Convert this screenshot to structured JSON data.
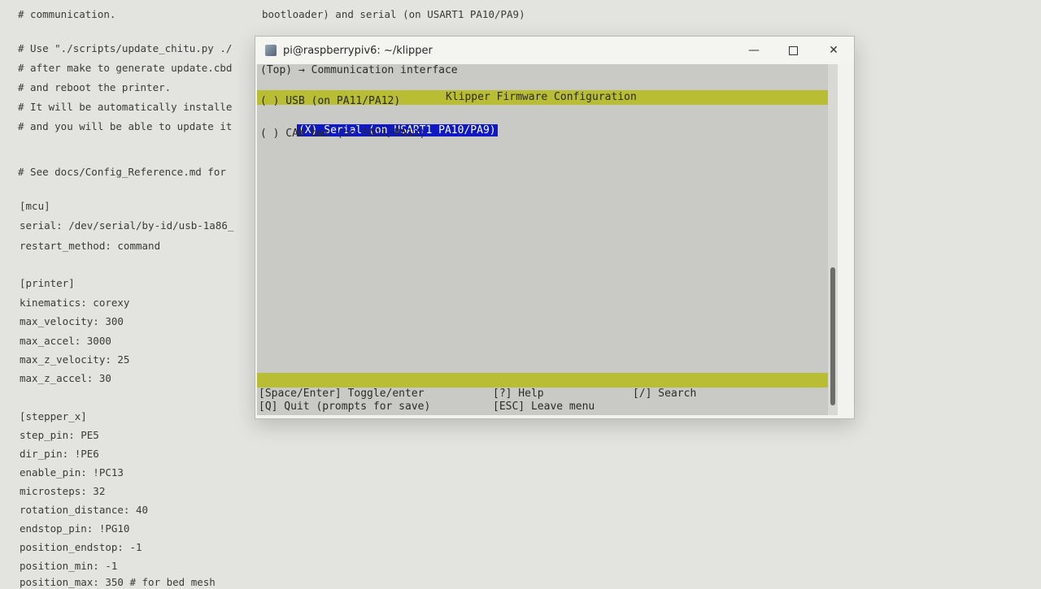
{
  "config_file": {
    "lines": [
      "# communication.",
      "",
      "# Use \"./scripts/update_chitu.py ./",
      "# after make to generate update.cbd",
      "# and reboot the printer.",
      "# It will be automatically installe",
      "# and you will be able to update it",
      "",
      "# See docs/Config_Reference.md for",
      "",
      "[mcu]",
      "serial: /dev/serial/by-id/usb-1a86_",
      "restart_method: command",
      "",
      "[printer]",
      "kinematics: corexy",
      "max_velocity: 300",
      "max_accel: 3000",
      "max_z_velocity: 25",
      "max_z_accel: 30",
      "",
      "[stepper_x]",
      "step_pin: PE5",
      "dir_pin: !PE6",
      "enable_pin: !PC13",
      "microsteps: 32",
      "rotation_distance: 40",
      "endstop_pin: !PG10",
      "position_endstop: -1",
      "position_min: -1",
      "position_max: 350 # for bed mesh"
    ],
    "top_fragment": "bootloader) and serial (on USART1 PA10/PA9)"
  },
  "window": {
    "title": "pi@raspberrypiv6: ~/klipper",
    "minimize_glyph": "—",
    "close_glyph": "✕"
  },
  "menu": {
    "breadcrumb": "(Top) → Communication interface",
    "header": "Klipper Firmware Configuration",
    "options": [
      "( ) USB (on PA11/PA12)",
      "(X) Serial (on USART1 PA10/PA9)",
      "( ) CAN bus (on PA11/PA12)"
    ],
    "footer": {
      "toggle": "[Space/Enter] Toggle/enter",
      "help": "[?] Help",
      "search": "[/] Search",
      "quit": "[Q] Quit (prompts for save)",
      "leave": "[ESC] Leave menu"
    }
  },
  "colors": {
    "highlight_bar": "#b9bd34",
    "selection": "#0e18c4"
  }
}
